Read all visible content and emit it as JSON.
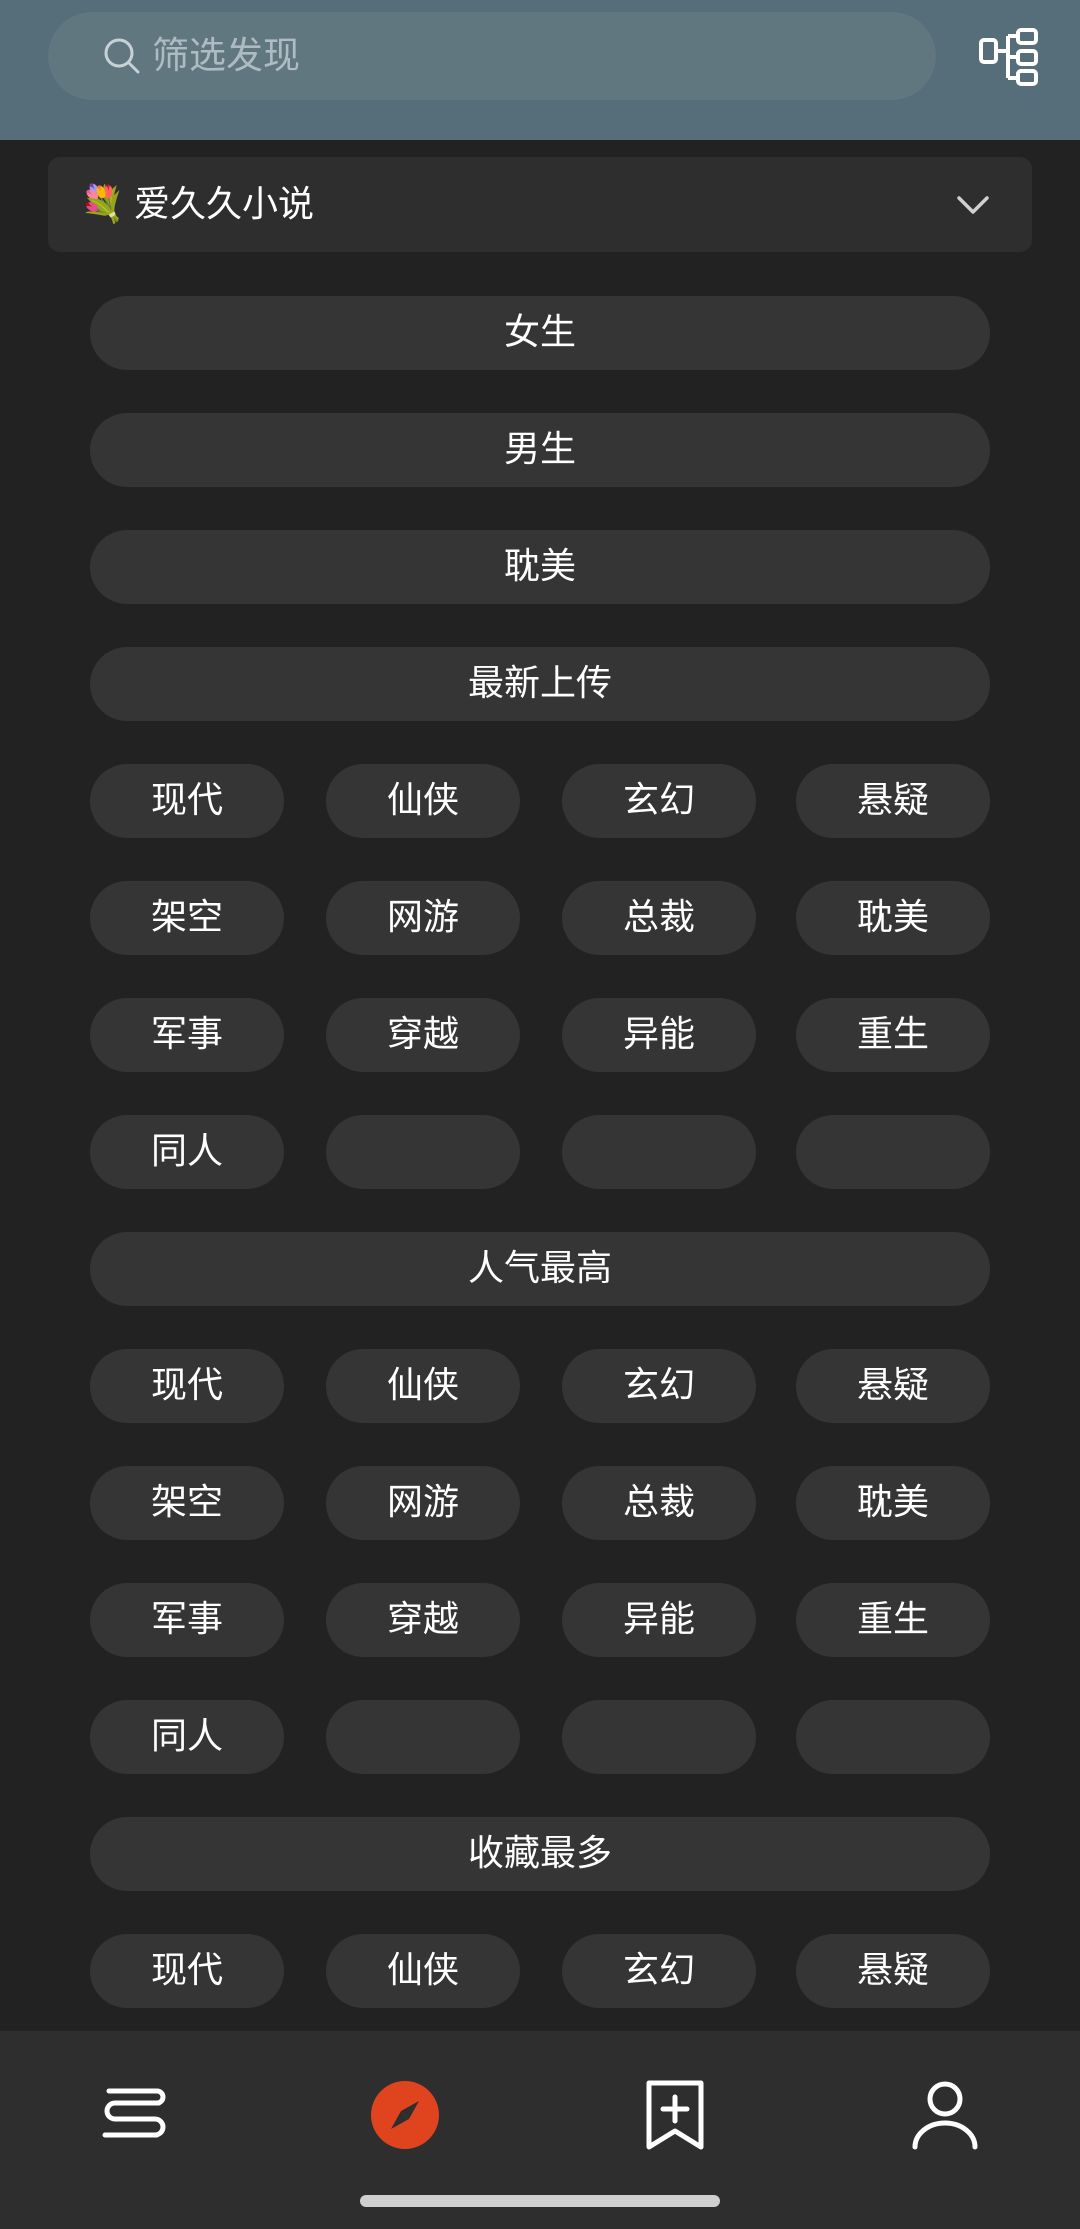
{
  "search": {
    "placeholder": "筛选发现"
  },
  "source": {
    "emoji": "💐",
    "name": "爱久久小说"
  },
  "sections": [
    {
      "title": "女生"
    },
    {
      "title": "男生"
    },
    {
      "title": "耽美"
    },
    {
      "title": "最新上传",
      "rows": [
        [
          "现代",
          "仙侠",
          "玄幻",
          "悬疑"
        ],
        [
          "架空",
          "网游",
          "总裁",
          "耽美"
        ],
        [
          "军事",
          "穿越",
          "异能",
          "重生"
        ],
        [
          "同人",
          "",
          "",
          ""
        ]
      ]
    },
    {
      "title": "人气最高",
      "rows": [
        [
          "现代",
          "仙侠",
          "玄幻",
          "悬疑"
        ],
        [
          "架空",
          "网游",
          "总裁",
          "耽美"
        ],
        [
          "军事",
          "穿越",
          "异能",
          "重生"
        ],
        [
          "同人",
          "",
          "",
          ""
        ]
      ]
    },
    {
      "title": "收藏最多",
      "rows": [
        [
          "现代",
          "仙侠",
          "玄幻",
          "悬疑"
        ]
      ]
    }
  ],
  "nav": [
    {
      "icon": "bookshelf-icon"
    },
    {
      "icon": "compass-icon",
      "active": true,
      "color": "#e0441f"
    },
    {
      "icon": "bookmark-add-icon"
    },
    {
      "icon": "person-icon"
    }
  ],
  "colors": {
    "header": "#566d7a",
    "background": "#222222",
    "pill": "#353535",
    "accent": "#e0441f"
  }
}
